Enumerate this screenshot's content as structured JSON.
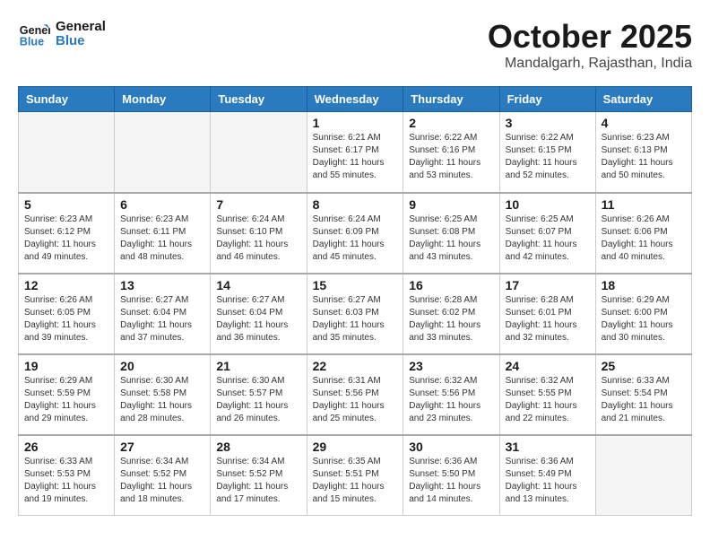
{
  "logo": {
    "line1": "General",
    "line2": "Blue"
  },
  "title": "October 2025",
  "location": "Mandalgarh, Rajasthan, India",
  "headers": [
    "Sunday",
    "Monday",
    "Tuesday",
    "Wednesday",
    "Thursday",
    "Friday",
    "Saturday"
  ],
  "weeks": [
    [
      {
        "day": "",
        "info": ""
      },
      {
        "day": "",
        "info": ""
      },
      {
        "day": "",
        "info": ""
      },
      {
        "day": "1",
        "info": "Sunrise: 6:21 AM\nSunset: 6:17 PM\nDaylight: 11 hours\nand 55 minutes."
      },
      {
        "day": "2",
        "info": "Sunrise: 6:22 AM\nSunset: 6:16 PM\nDaylight: 11 hours\nand 53 minutes."
      },
      {
        "day": "3",
        "info": "Sunrise: 6:22 AM\nSunset: 6:15 PM\nDaylight: 11 hours\nand 52 minutes."
      },
      {
        "day": "4",
        "info": "Sunrise: 6:23 AM\nSunset: 6:13 PM\nDaylight: 11 hours\nand 50 minutes."
      }
    ],
    [
      {
        "day": "5",
        "info": "Sunrise: 6:23 AM\nSunset: 6:12 PM\nDaylight: 11 hours\nand 49 minutes."
      },
      {
        "day": "6",
        "info": "Sunrise: 6:23 AM\nSunset: 6:11 PM\nDaylight: 11 hours\nand 48 minutes."
      },
      {
        "day": "7",
        "info": "Sunrise: 6:24 AM\nSunset: 6:10 PM\nDaylight: 11 hours\nand 46 minutes."
      },
      {
        "day": "8",
        "info": "Sunrise: 6:24 AM\nSunset: 6:09 PM\nDaylight: 11 hours\nand 45 minutes."
      },
      {
        "day": "9",
        "info": "Sunrise: 6:25 AM\nSunset: 6:08 PM\nDaylight: 11 hours\nand 43 minutes."
      },
      {
        "day": "10",
        "info": "Sunrise: 6:25 AM\nSunset: 6:07 PM\nDaylight: 11 hours\nand 42 minutes."
      },
      {
        "day": "11",
        "info": "Sunrise: 6:26 AM\nSunset: 6:06 PM\nDaylight: 11 hours\nand 40 minutes."
      }
    ],
    [
      {
        "day": "12",
        "info": "Sunrise: 6:26 AM\nSunset: 6:05 PM\nDaylight: 11 hours\nand 39 minutes."
      },
      {
        "day": "13",
        "info": "Sunrise: 6:27 AM\nSunset: 6:04 PM\nDaylight: 11 hours\nand 37 minutes."
      },
      {
        "day": "14",
        "info": "Sunrise: 6:27 AM\nSunset: 6:04 PM\nDaylight: 11 hours\nand 36 minutes."
      },
      {
        "day": "15",
        "info": "Sunrise: 6:27 AM\nSunset: 6:03 PM\nDaylight: 11 hours\nand 35 minutes."
      },
      {
        "day": "16",
        "info": "Sunrise: 6:28 AM\nSunset: 6:02 PM\nDaylight: 11 hours\nand 33 minutes."
      },
      {
        "day": "17",
        "info": "Sunrise: 6:28 AM\nSunset: 6:01 PM\nDaylight: 11 hours\nand 32 minutes."
      },
      {
        "day": "18",
        "info": "Sunrise: 6:29 AM\nSunset: 6:00 PM\nDaylight: 11 hours\nand 30 minutes."
      }
    ],
    [
      {
        "day": "19",
        "info": "Sunrise: 6:29 AM\nSunset: 5:59 PM\nDaylight: 11 hours\nand 29 minutes."
      },
      {
        "day": "20",
        "info": "Sunrise: 6:30 AM\nSunset: 5:58 PM\nDaylight: 11 hours\nand 28 minutes."
      },
      {
        "day": "21",
        "info": "Sunrise: 6:30 AM\nSunset: 5:57 PM\nDaylight: 11 hours\nand 26 minutes."
      },
      {
        "day": "22",
        "info": "Sunrise: 6:31 AM\nSunset: 5:56 PM\nDaylight: 11 hours\nand 25 minutes."
      },
      {
        "day": "23",
        "info": "Sunrise: 6:32 AM\nSunset: 5:56 PM\nDaylight: 11 hours\nand 23 minutes."
      },
      {
        "day": "24",
        "info": "Sunrise: 6:32 AM\nSunset: 5:55 PM\nDaylight: 11 hours\nand 22 minutes."
      },
      {
        "day": "25",
        "info": "Sunrise: 6:33 AM\nSunset: 5:54 PM\nDaylight: 11 hours\nand 21 minutes."
      }
    ],
    [
      {
        "day": "26",
        "info": "Sunrise: 6:33 AM\nSunset: 5:53 PM\nDaylight: 11 hours\nand 19 minutes."
      },
      {
        "day": "27",
        "info": "Sunrise: 6:34 AM\nSunset: 5:52 PM\nDaylight: 11 hours\nand 18 minutes."
      },
      {
        "day": "28",
        "info": "Sunrise: 6:34 AM\nSunset: 5:52 PM\nDaylight: 11 hours\nand 17 minutes."
      },
      {
        "day": "29",
        "info": "Sunrise: 6:35 AM\nSunset: 5:51 PM\nDaylight: 11 hours\nand 15 minutes."
      },
      {
        "day": "30",
        "info": "Sunrise: 6:36 AM\nSunset: 5:50 PM\nDaylight: 11 hours\nand 14 minutes."
      },
      {
        "day": "31",
        "info": "Sunrise: 6:36 AM\nSunset: 5:49 PM\nDaylight: 11 hours\nand 13 minutes."
      },
      {
        "day": "",
        "info": ""
      }
    ]
  ]
}
